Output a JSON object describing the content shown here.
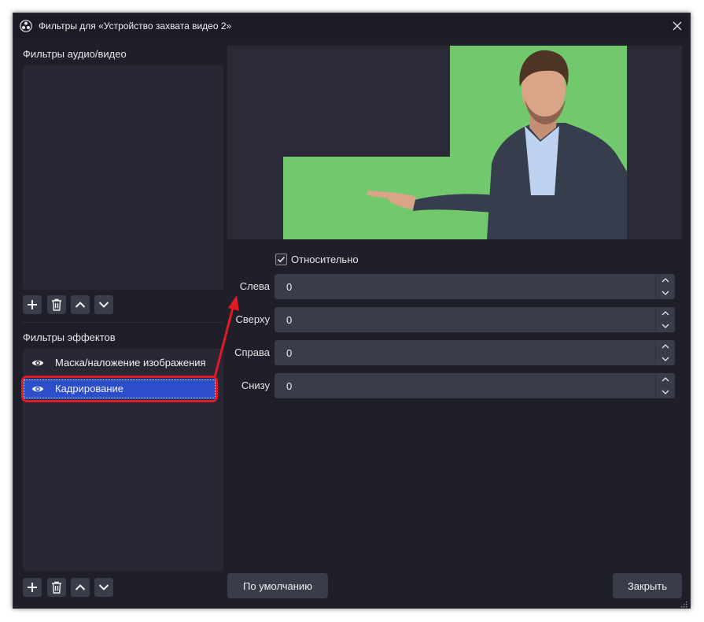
{
  "window": {
    "title": "Фильтры для «Устройство захвата видео 2»"
  },
  "audio_video_filters": {
    "label": "Фильтры аудио/видео",
    "items": []
  },
  "effect_filters": {
    "label": "Фильтры эффектов",
    "items": [
      {
        "label": "Маска/наложение изображения",
        "visible": true,
        "selected": false
      },
      {
        "label": "Кадрирование",
        "visible": true,
        "selected": true
      }
    ]
  },
  "properties": {
    "relative_label": "Относительно",
    "relative_checked": true,
    "fields": [
      {
        "label": "Слева",
        "value": "0"
      },
      {
        "label": "Сверху",
        "value": "0"
      },
      {
        "label": "Справа",
        "value": "0"
      },
      {
        "label": "Снизу",
        "value": "0"
      }
    ]
  },
  "footer": {
    "defaults_label": "По умолчанию",
    "close_label": "Закрыть"
  },
  "colors": {
    "window_bg": "#1e1f29",
    "selection": "#2c4ecb",
    "annotation": "#e01b24",
    "chroma_green": "#72c86c"
  }
}
